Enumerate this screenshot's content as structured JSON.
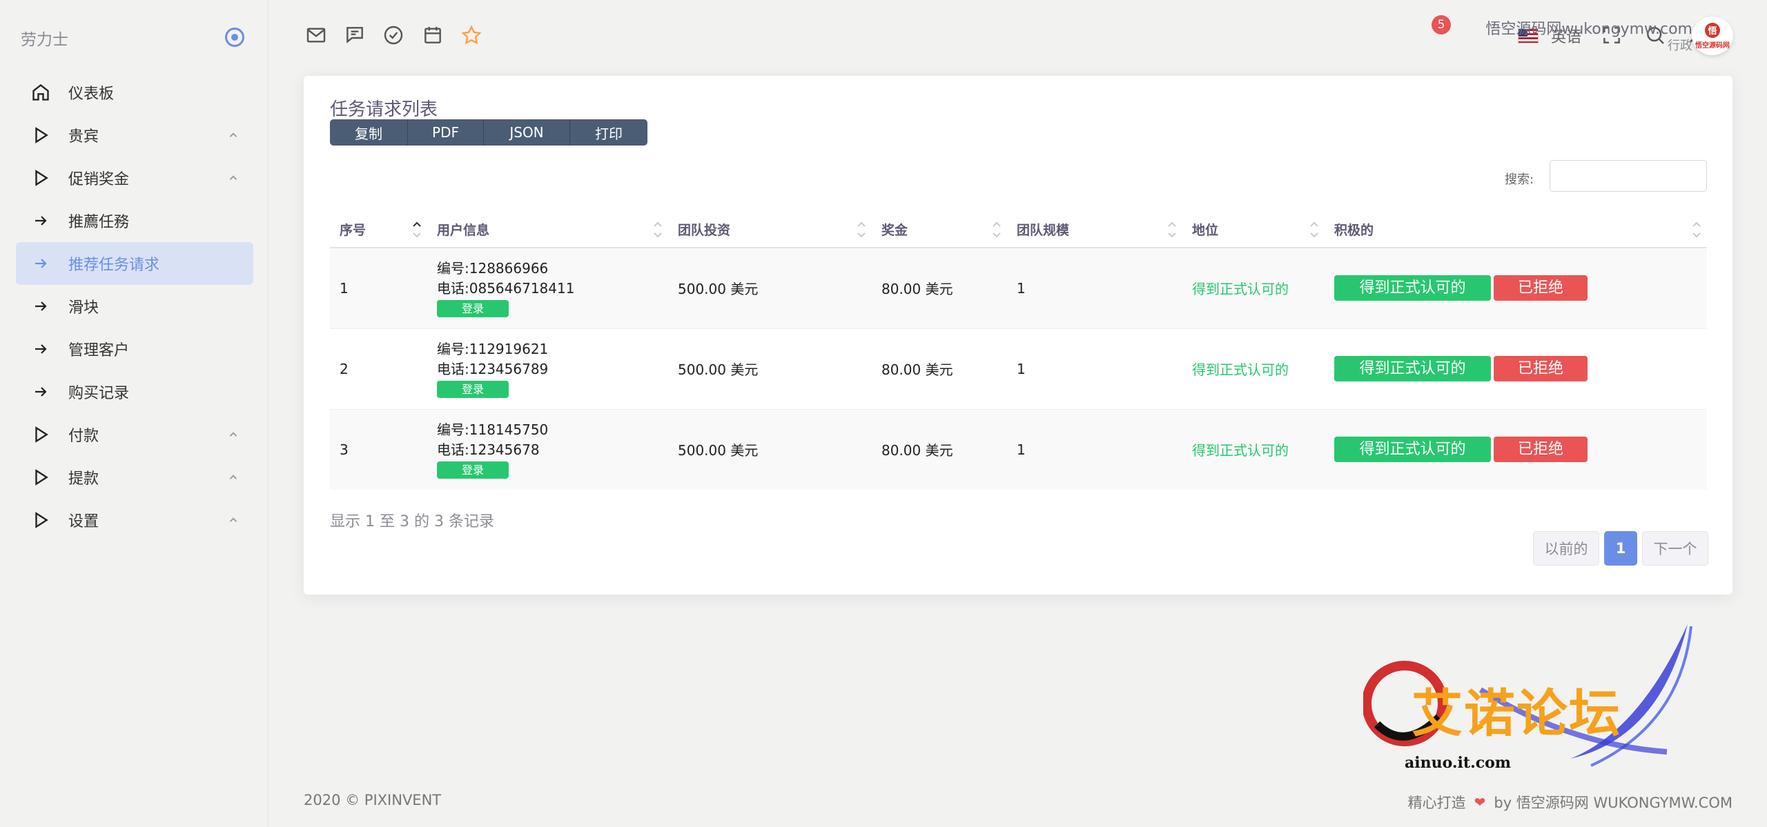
{
  "sidebar": {
    "brand": "劳力士",
    "items": [
      {
        "label": "仪表板",
        "icon": "home-icon",
        "expandable": false,
        "active": false
      },
      {
        "label": "贵宾",
        "icon": "play-icon",
        "expandable": true,
        "active": false
      },
      {
        "label": "促销奖金",
        "icon": "play-icon",
        "expandable": true,
        "active": false
      },
      {
        "label": "推薦任務",
        "icon": "arrow-right-icon",
        "expandable": false,
        "active": false
      },
      {
        "label": "推荐任务请求",
        "icon": "arrow-right-icon",
        "expandable": false,
        "active": true
      },
      {
        "label": "滑块",
        "icon": "arrow-right-icon",
        "expandable": false,
        "active": false
      },
      {
        "label": "管理客户",
        "icon": "arrow-right-icon",
        "expandable": false,
        "active": false
      },
      {
        "label": "购买记录",
        "icon": "arrow-right-icon",
        "expandable": false,
        "active": false
      },
      {
        "label": "付款",
        "icon": "play-icon",
        "expandable": true,
        "active": false
      },
      {
        "label": "提款",
        "icon": "play-icon",
        "expandable": true,
        "active": false
      },
      {
        "label": "设置",
        "icon": "play-icon",
        "expandable": true,
        "active": false
      }
    ]
  },
  "topbar": {
    "language": "英语",
    "notification_count": "5",
    "user_name": "悟空源码网wukongymw.com",
    "user_role": "行政",
    "avatar_badge": "悟",
    "avatar_text": "悟空源码网"
  },
  "card": {
    "title": "任务请求列表",
    "export_buttons": [
      "复制",
      "PDF",
      "JSON",
      "打印"
    ],
    "search_label": "搜索:",
    "search_value": ""
  },
  "table": {
    "headers": [
      "序号",
      "用户信息",
      "团队投资",
      "奖金",
      "团队规模",
      "地位",
      "积极的"
    ],
    "rows": [
      {
        "index": "1",
        "id_label": "编号:",
        "id": "128866966",
        "phone_label": "电话:",
        "phone": "085646718411",
        "login": "登录",
        "investment_value": "500.00",
        "investment_unit": "美元",
        "bonus_value": "80.00",
        "bonus_unit": "美元",
        "team_size": "1",
        "status": "得到正式认可的",
        "approve": "得到正式认可的",
        "reject": "已拒绝"
      },
      {
        "index": "2",
        "id_label": "编号:",
        "id": "112919621",
        "phone_label": "电话:",
        "phone": "123456789",
        "login": "登录",
        "investment_value": "500.00",
        "investment_unit": "美元",
        "bonus_value": "80.00",
        "bonus_unit": "美元",
        "team_size": "1",
        "status": "得到正式认可的",
        "approve": "得到正式认可的",
        "reject": "已拒绝"
      },
      {
        "index": "3",
        "id_label": "编号:",
        "id": "118145750",
        "phone_label": "电话:",
        "phone": "12345678",
        "login": "登录",
        "investment_value": "500.00",
        "investment_unit": "美元",
        "bonus_value": "80.00",
        "bonus_unit": "美元",
        "team_size": "1",
        "status": "得到正式认可的",
        "approve": "得到正式认可的",
        "reject": "已拒绝"
      }
    ],
    "info": "显示 1 至 3 的 3 条记录"
  },
  "pagination": {
    "prev": "以前的",
    "current": "1",
    "next": "下一个"
  },
  "footer": {
    "copyright": "2020 © PIXINVENT",
    "made_with": "精心打造",
    "by": "by 悟空源码网 WUKONGYMW.COM"
  },
  "watermark": {
    "title": "艾诺论坛",
    "url": "ainuo.it.com"
  },
  "colors": {
    "accent": "#6a8ee8",
    "success": "#28c76f",
    "danger": "#ea5455",
    "export_button": "#4b5c75"
  }
}
